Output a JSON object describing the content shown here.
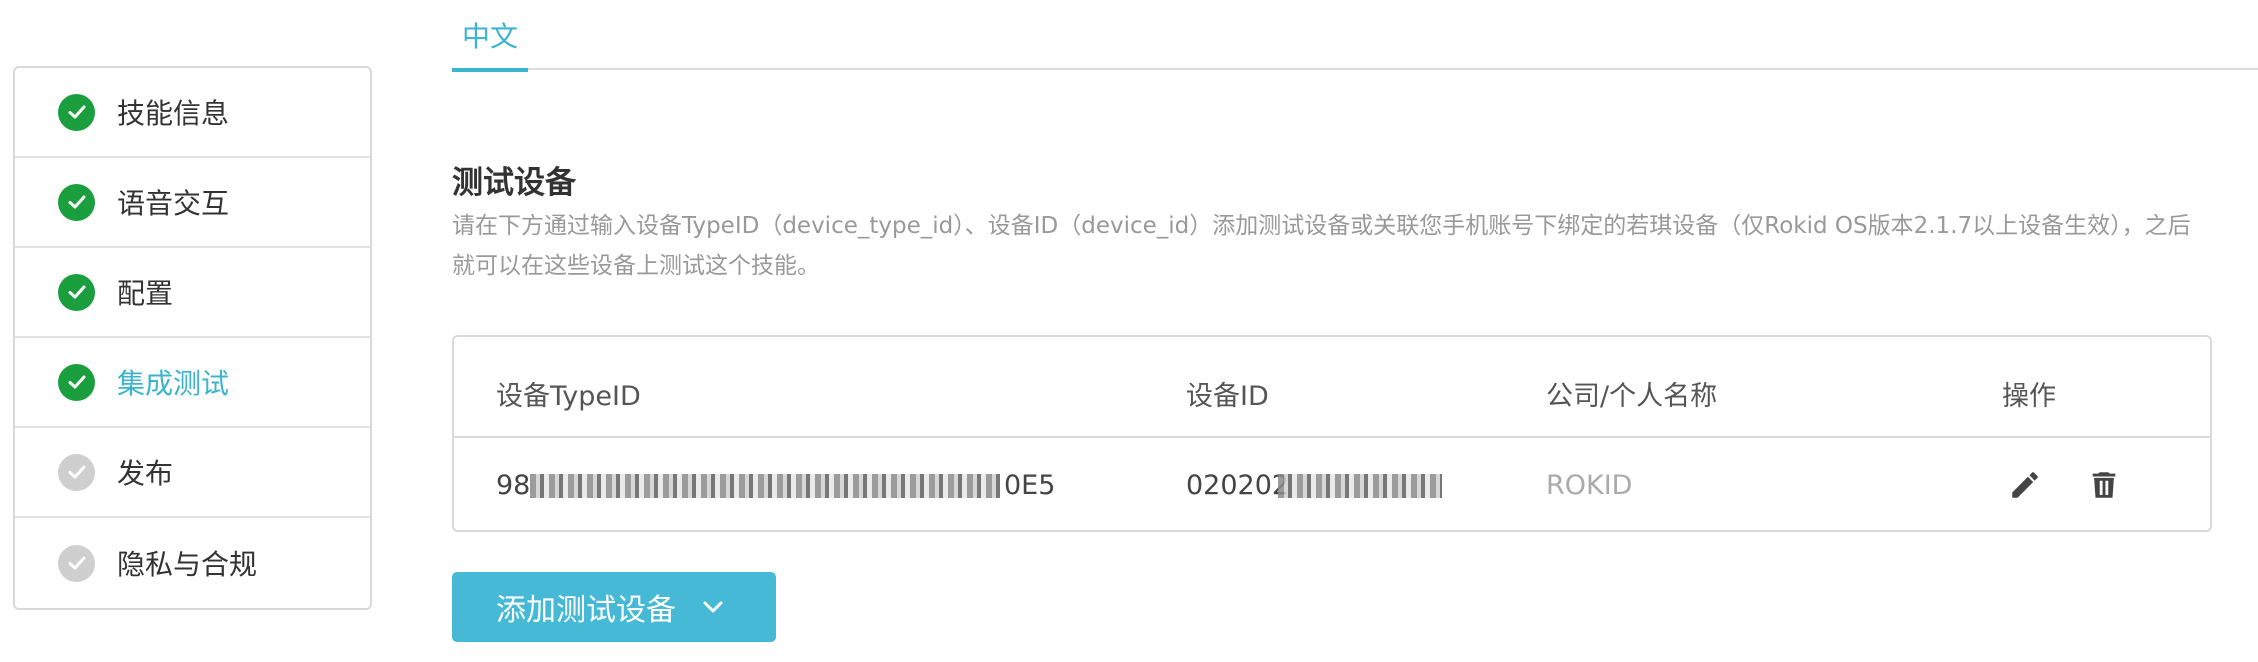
{
  "steps": [
    {
      "label": "技能信息",
      "status": "done"
    },
    {
      "label": "语音交互",
      "status": "done"
    },
    {
      "label": "配置",
      "status": "done"
    },
    {
      "label": "集成测试",
      "status": "done",
      "active": true
    },
    {
      "label": "发布",
      "status": "todo"
    },
    {
      "label": "隐私与合规",
      "status": "todo"
    }
  ],
  "language_tab": "中文",
  "section": {
    "title": "测试设备",
    "description": "请在下方通过输入设备TypeID（device_type_id）、设备ID（device_id）添加测试设备或关联您手机账号下绑定的若琪设备（仅Rokid OS版本2.1.7以上设备生效），之后就可以在这些设备上测试这个技能。"
  },
  "table": {
    "headers": [
      "设备TypeID",
      "设备ID",
      "公司/个人名称",
      "操作"
    ],
    "rows": [
      {
        "type_id_prefix": "98",
        "type_id_suffix": "0E5",
        "device_id_prefix": "020202",
        "company": "ROKID"
      }
    ]
  },
  "add_button": {
    "label": "添加测试设备"
  },
  "colors": {
    "accent": "#3bb4d0",
    "button": "#45b9d5",
    "done": "#1a9e3e",
    "todo": "#cfcfcf"
  }
}
